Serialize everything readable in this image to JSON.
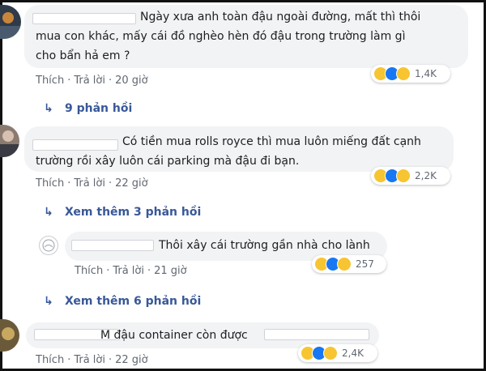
{
  "comments": [
    {
      "line1": "Ngày xưa anh toàn đậu ngoài đường, mất thì thôi",
      "line2": "mua con khác, mấy cái đồ nghèo hèn đó đậu trong trường làm gì",
      "line3": "cho bẩn hả em ?",
      "like": "Thích",
      "reply": "Trả lời",
      "time": "20 giờ",
      "reaction_count": "1,4K",
      "replies_link": "9 phản hồi"
    },
    {
      "line1": "Có tiền mua rolls royce thì mua luôn miếng đất cạnh",
      "line2": "trường rồi xây luôn cái parking mà đậu đi bạn.",
      "like": "Thích",
      "reply": "Trả lời",
      "time": "22 giờ",
      "reaction_count": "2,2K",
      "replies_link": "Xem thêm 3 phản hồi"
    },
    {
      "line1": "Thôi xây cái trường gần nhà cho lành",
      "like": "Thích",
      "reply": "Trả lời",
      "time": "21 giờ",
      "reaction_count": "257",
      "replies_link": "Xem thêm 6 phản hồi"
    },
    {
      "line1": "M đậu container còn được",
      "like": "Thích",
      "reply": "Trả lời",
      "time": "22 giờ",
      "reaction_count": "2,4K"
    }
  ],
  "icons": {
    "reply_arrow": "reply-arrow-icon",
    "haha": "haha-reaction-icon",
    "like": "like-reaction-icon",
    "sad": "sad-reaction-icon",
    "wow": "wow-reaction-icon"
  },
  "colors": {
    "bubble": "#f2f3f5",
    "link": "#385898",
    "meta": "#606770",
    "like_blue": "#1877f2",
    "emoji_yellow": "#f7c531"
  }
}
